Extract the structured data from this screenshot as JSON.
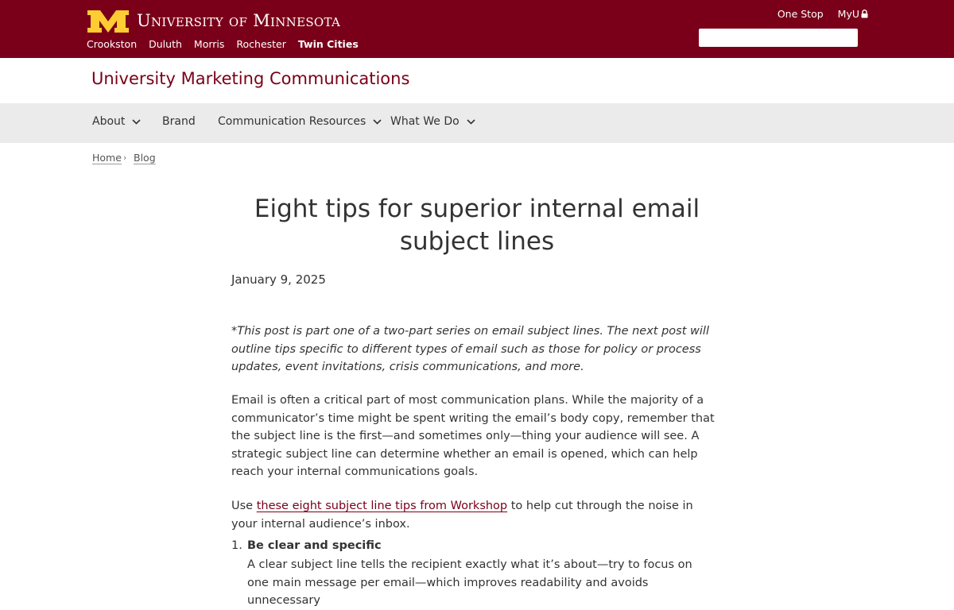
{
  "header": {
    "wordmark": "University of Minnesota",
    "campuses": [
      "Crookston",
      "Duluth",
      "Morris",
      "Rochester",
      "Twin Cities"
    ],
    "active_campus": "Twin Cities",
    "utility_links": {
      "one_stop": "One Stop",
      "myu": "MyU"
    },
    "search_placeholder": "",
    "colors": {
      "maroon": "#7a0019",
      "gold": "#ffcc33"
    }
  },
  "site": {
    "title": "University Marketing Communications"
  },
  "nav": {
    "items": [
      {
        "label": "About",
        "has_dropdown": true
      },
      {
        "label": "Brand",
        "has_dropdown": false
      },
      {
        "label": "Communication Resources",
        "has_dropdown": true
      },
      {
        "label": "What We Do",
        "has_dropdown": true
      }
    ]
  },
  "breadcrumb": {
    "home": "Home",
    "blog": "Blog"
  },
  "article": {
    "title": "Eight tips for superior internal email subject lines",
    "date": "January 9, 2025",
    "intro_note": "*This post is part one of a two-part series on email subject lines. The next post will outline tips specific to different types of email such as those for policy or process updates, event invitations, crisis communications, and more.",
    "paragraph1": "Email is often a critical part of most communication plans. While the majority of a communicator’s time might be spent writing the email’s body copy, remember that the subject line is the first—and sometimes only—thing your audience will see. A strategic subject line can determine whether an email is opened, which can help reach your internal communications goals.",
    "paragraph2_before": "Use ",
    "paragraph2_link": "these eight subject line tips from Workshop",
    "paragraph2_after": " to help cut through the noise in your internal audience’s inbox.",
    "list": [
      {
        "number": "1.",
        "heading": "Be clear and specific",
        "body": "A clear subject line tells the recipient exactly what it’s about—try to focus on one main message per email—which improves readability and avoids unnecessary"
      }
    ]
  }
}
